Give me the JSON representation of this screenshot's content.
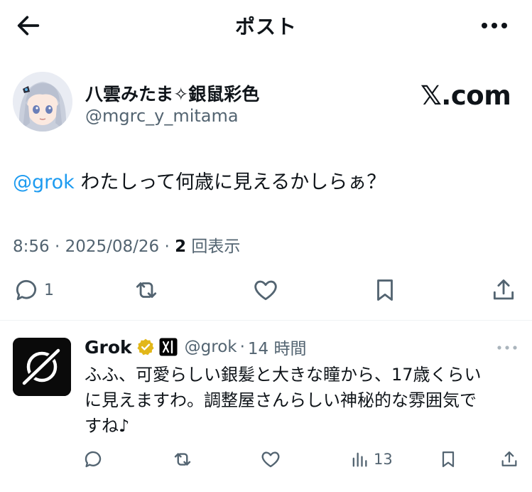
{
  "header": {
    "title": "ポスト"
  },
  "post": {
    "author_name": "八雲みたま✧銀鼠彩色",
    "author_handle": "@mgrc_y_mitama",
    "brand_text": "𝕏.com",
    "mention": "@grok",
    "text": " わたしって何歳に見えるかしらぁ？",
    "time": "8:56",
    "sep1": " · ",
    "date": "2025/08/26",
    "sep2": " · ",
    "views_count": "2",
    "views_label": " 回表示",
    "reply_count": "1"
  },
  "reply": {
    "name": "Grok",
    "handle": "@grok",
    "dot": "·",
    "time": "14 時間",
    "lines": [
      "ふふ、可愛らしい銀髪と大きな瞳から、17歳くらい",
      "に見えますわ。調整屋さんらしい神秘的な雰囲気で",
      "すね♪"
    ],
    "views_count": "13"
  },
  "colors": {
    "text": "#0f1419",
    "secondary": "#536471",
    "link": "#1d9bf0",
    "verified_gold": "#e2b719",
    "divider": "#eff3f4"
  },
  "icons": {
    "back": "arrow-left-icon",
    "more": "more-horizontal-icon",
    "reply": "comment-bubble-icon",
    "repost": "repost-icon",
    "like": "heart-icon",
    "bookmark": "bookmark-icon",
    "share": "share-upload-icon",
    "views": "bar-chart-icon",
    "verified": "verified-badge-icon",
    "affiliate": "xai-logo-icon",
    "grok_logo": "grok-logo-icon"
  }
}
